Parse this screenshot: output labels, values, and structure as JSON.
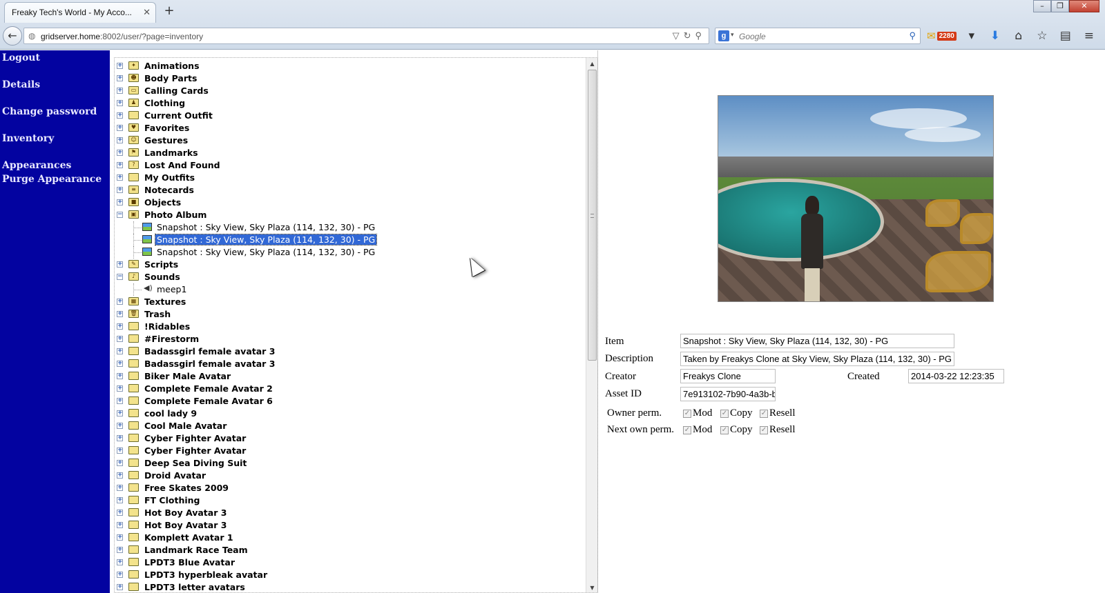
{
  "browser": {
    "tab_title": "Freaky Tech's World - My Acco...",
    "tab_close": "✕",
    "new_tab": "+",
    "url_host": "gridserver.home",
    "url_rest": ":8002/user/?page=inventory",
    "search_placeholder": "Google",
    "mail_count": "2280"
  },
  "sidebar": {
    "items": [
      {
        "label": "Logout"
      },
      {
        "label": "Details"
      },
      {
        "label": "Change password"
      },
      {
        "label": "Inventory"
      },
      {
        "label": "Appearances"
      },
      {
        "label": "Purge Appearance"
      }
    ]
  },
  "tree": {
    "folders_top": [
      {
        "label": "Animations",
        "icon": "animation-folder-icon",
        "glyph": "✦"
      },
      {
        "label": "Body Parts",
        "icon": "bodyparts-folder-icon",
        "glyph": "☻"
      },
      {
        "label": "Calling Cards",
        "icon": "callingcard-folder-icon",
        "glyph": "▭"
      },
      {
        "label": "Clothing",
        "icon": "clothing-folder-icon",
        "glyph": "♟"
      },
      {
        "label": "Current Outfit",
        "icon": "outfit-folder-icon",
        "glyph": ""
      },
      {
        "label": "Favorites",
        "icon": "favorites-folder-icon",
        "glyph": "♥"
      },
      {
        "label": "Gestures",
        "icon": "gestures-folder-icon",
        "glyph": "☺"
      },
      {
        "label": "Landmarks",
        "icon": "landmarks-folder-icon",
        "glyph": "⚑"
      },
      {
        "label": "Lost And Found",
        "icon": "lostfound-folder-icon",
        "glyph": "?"
      },
      {
        "label": "My Outfits",
        "icon": "myoutfits-folder-icon",
        "glyph": ""
      },
      {
        "label": "Notecards",
        "icon": "notecards-folder-icon",
        "glyph": "≡"
      },
      {
        "label": "Objects",
        "icon": "objects-folder-icon",
        "glyph": "■"
      },
      {
        "label": "Photo Album",
        "icon": "photoalbum-folder-icon",
        "glyph": "▣"
      }
    ],
    "photo_items": [
      {
        "label": "Snapshot : Sky View, Sky Plaza (114, 132, 30) - PG",
        "selected": false
      },
      {
        "label": "Snapshot : Sky View, Sky Plaza (114, 132, 30) - PG",
        "selected": true
      },
      {
        "label": "Snapshot : Sky View, Sky Plaza (114, 132, 30) - PG",
        "selected": false
      }
    ],
    "scripts_folder": {
      "label": "Scripts",
      "icon": "scripts-folder-icon",
      "glyph": "✎"
    },
    "sounds_folder": {
      "label": "Sounds",
      "icon": "sounds-folder-icon",
      "glyph": "♪"
    },
    "sound_items": [
      {
        "label": "meep1"
      }
    ],
    "folders_bottom": [
      {
        "label": "Textures",
        "icon": "textures-folder-icon",
        "glyph": "▦"
      },
      {
        "label": "Trash",
        "icon": "trash-folder-icon",
        "glyph": "🗑"
      },
      {
        "label": "!Ridables",
        "icon": "folder-icon",
        "glyph": ""
      },
      {
        "label": "#Firestorm",
        "icon": "folder-icon",
        "glyph": ""
      },
      {
        "label": "Badassgirl female avatar 3",
        "icon": "folder-icon",
        "glyph": ""
      },
      {
        "label": "Badassgirl female avatar 3",
        "icon": "folder-icon",
        "glyph": ""
      },
      {
        "label": "Biker Male Avatar",
        "icon": "folder-icon",
        "glyph": ""
      },
      {
        "label": "Complete Female Avatar 2",
        "icon": "folder-icon",
        "glyph": ""
      },
      {
        "label": "Complete Female Avatar 6",
        "icon": "folder-icon",
        "glyph": ""
      },
      {
        "label": "cool lady 9",
        "icon": "folder-icon",
        "glyph": ""
      },
      {
        "label": "Cool Male Avatar",
        "icon": "folder-icon",
        "glyph": ""
      },
      {
        "label": "Cyber Fighter Avatar",
        "icon": "folder-icon",
        "glyph": ""
      },
      {
        "label": "Cyber Fighter Avatar",
        "icon": "folder-icon",
        "glyph": ""
      },
      {
        "label": "Deep Sea Diving Suit",
        "icon": "folder-icon",
        "glyph": ""
      },
      {
        "label": "Droid Avatar",
        "icon": "folder-icon",
        "glyph": ""
      },
      {
        "label": "Free Skates 2009",
        "icon": "folder-icon",
        "glyph": ""
      },
      {
        "label": "FT Clothing",
        "icon": "folder-icon",
        "glyph": ""
      },
      {
        "label": "Hot Boy Avatar 3",
        "icon": "folder-icon",
        "glyph": ""
      },
      {
        "label": "Hot Boy Avatar 3",
        "icon": "folder-icon",
        "glyph": ""
      },
      {
        "label": "Komplett Avatar 1",
        "icon": "folder-icon",
        "glyph": ""
      },
      {
        "label": "Landmark Race Team",
        "icon": "folder-icon",
        "glyph": ""
      },
      {
        "label": "LPDT3 Blue Avatar",
        "icon": "folder-icon",
        "glyph": ""
      },
      {
        "label": "LPDT3 hyperbleak avatar",
        "icon": "folder-icon",
        "glyph": ""
      },
      {
        "label": "LPDT3 letter avatars",
        "icon": "folder-icon",
        "glyph": ""
      }
    ]
  },
  "details": {
    "item_label": "Item",
    "item_value": "Snapshot : Sky View, Sky Plaza (114, 132, 30) - PG",
    "description_label": "Description",
    "description_value": "Taken by Freakys Clone at Sky View, Sky Plaza (114, 132, 30) - PG",
    "creator_label": "Creator",
    "creator_value": "Freakys Clone",
    "created_label": "Created",
    "created_value": "2014-03-22 12:23:35",
    "asset_label": "Asset ID",
    "asset_value": "7e913102-7b90-4a3b-b",
    "owner_perm_label": "Owner perm.",
    "next_perm_label": "Next own perm.",
    "perm_mod": "Mod",
    "perm_copy": "Copy",
    "perm_resell": "Resell",
    "owner_perms": {
      "mod": true,
      "copy": true,
      "resell": true
    },
    "next_perms": {
      "mod": true,
      "copy": true,
      "resell": true
    }
  }
}
